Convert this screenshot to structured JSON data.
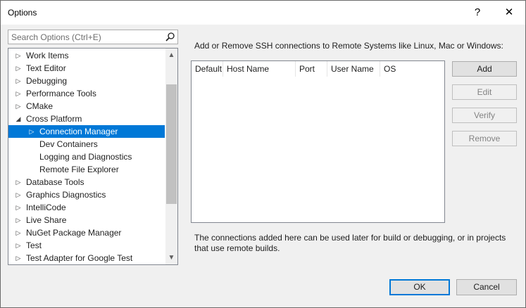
{
  "window": {
    "title": "Options",
    "help_glyph": "?",
    "close_glyph": "✕"
  },
  "search": {
    "placeholder": "Search Options (Ctrl+E)",
    "value": "",
    "icon": "search-icon"
  },
  "tree": {
    "items": [
      {
        "label": "Work Items",
        "level": 0,
        "expander": "collapsed"
      },
      {
        "label": "Text Editor",
        "level": 0,
        "expander": "collapsed"
      },
      {
        "label": "Debugging",
        "level": 0,
        "expander": "collapsed"
      },
      {
        "label": "Performance Tools",
        "level": 0,
        "expander": "collapsed"
      },
      {
        "label": "CMake",
        "level": 0,
        "expander": "collapsed"
      },
      {
        "label": "Cross Platform",
        "level": 0,
        "expander": "expanded"
      },
      {
        "label": "Connection Manager",
        "level": 1,
        "expander": "collapsed",
        "selected": true
      },
      {
        "label": "Dev Containers",
        "level": 1,
        "expander": "none"
      },
      {
        "label": "Logging and Diagnostics",
        "level": 1,
        "expander": "none"
      },
      {
        "label": "Remote File Explorer",
        "level": 1,
        "expander": "none"
      },
      {
        "label": "Database Tools",
        "level": 0,
        "expander": "collapsed"
      },
      {
        "label": "Graphics Diagnostics",
        "level": 0,
        "expander": "collapsed"
      },
      {
        "label": "IntelliCode",
        "level": 0,
        "expander": "collapsed"
      },
      {
        "label": "Live Share",
        "level": 0,
        "expander": "collapsed"
      },
      {
        "label": "NuGet Package Manager",
        "level": 0,
        "expander": "collapsed"
      },
      {
        "label": "Test",
        "level": 0,
        "expander": "collapsed"
      },
      {
        "label": "Test Adapter for Google Test",
        "level": 0,
        "expander": "collapsed"
      }
    ],
    "scroll_up_glyph": "▲",
    "scroll_down_glyph": "▼"
  },
  "panel": {
    "description": "Add or Remove SSH connections to Remote Systems like Linux, Mac or Windows:",
    "columns": [
      "Default",
      "Host Name",
      "Port",
      "User Name",
      "OS"
    ],
    "rows": [],
    "note": "The connections added here can be used later for build or debugging, or in projects that use remote builds."
  },
  "buttons": {
    "add": {
      "label": "Add",
      "enabled": true
    },
    "edit": {
      "label": "Edit",
      "enabled": false
    },
    "verify": {
      "label": "Verify",
      "enabled": false
    },
    "remove": {
      "label": "Remove",
      "enabled": false
    }
  },
  "footer": {
    "ok_label": "OK",
    "cancel_label": "Cancel"
  },
  "colors": {
    "accent": "#0078d7",
    "window_bg": "#f0f0f0",
    "disabled_text": "#838383"
  }
}
